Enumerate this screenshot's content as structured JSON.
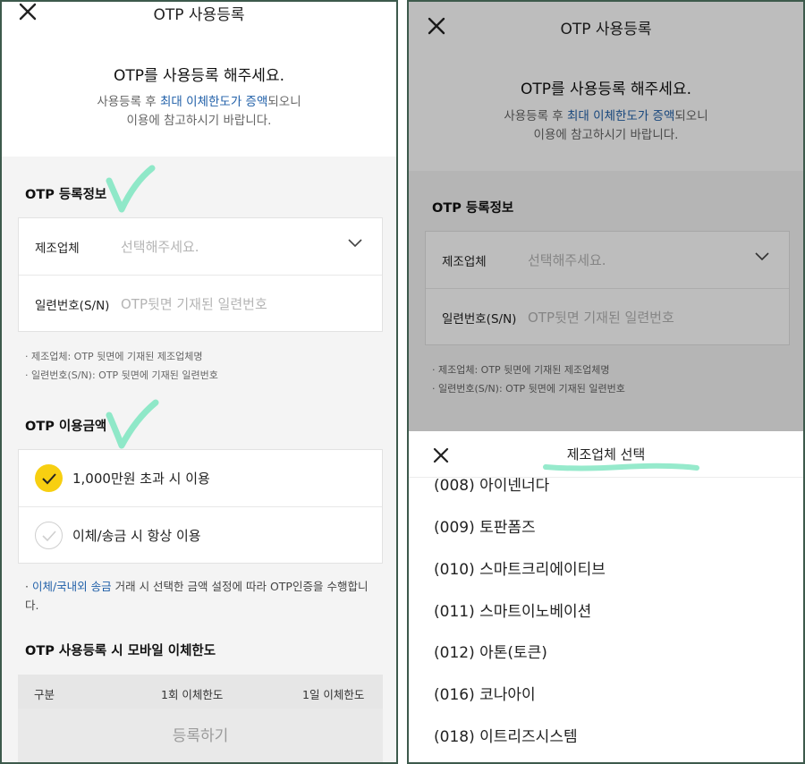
{
  "left": {
    "header_title": "OTP 사용등록",
    "intro": {
      "heading": "OTP를 사용등록 해주세요.",
      "line1_pre": "사용등록 후 ",
      "line1_highlight": "최대 이체한도가 증액",
      "line1_post": "되오니",
      "line2": "이용에 참고하시기 바랍니다."
    },
    "reg_section_title": "OTP 등록정보",
    "manufacturer": {
      "label": "제조업체",
      "placeholder": "선택해주세요."
    },
    "serial": {
      "label": "일련번호(S/N)",
      "placeholder": "OTP뒷면 기재된 일련번호"
    },
    "notes": [
      "· 제조업체: OTP 뒷면에 기재된 제조업체명",
      "· 일련번호(S/N): OTP 뒷면에 기재된 일련번호"
    ],
    "amount_section_title": "OTP 이용금액",
    "options": [
      {
        "label": "1,000만원 초과 시 이용",
        "selected": true
      },
      {
        "label": "이체/송금 시 항상 이용",
        "selected": false
      }
    ],
    "info": {
      "bullet": "· ",
      "link": "이체/국내외 송금",
      "text": " 거래 시 선택한 금액 설정에 따라 OTP인증을 수행합니다."
    },
    "limit_title": "OTP 사용등록 시 모바일 이체한도",
    "limit_headers": [
      "구분",
      "1회 이체한도",
      "1일 이체한도"
    ],
    "submit_label": "등록하기",
    "accent_color": "#f7cf11",
    "link_color": "#1f5fa8"
  },
  "right": {
    "header_title": "OTP 사용등록",
    "sheet_title": "제조업체 선택",
    "vendors": [
      "(008) 아이넨너다",
      "(009) 토판폼즈",
      "(010) 스마트크리에이티브",
      "(011) 스마트이노베이션",
      "(012) 아톤(토큰)",
      "(016) 코나아이",
      "(018) 이트리즈시스템"
    ]
  }
}
